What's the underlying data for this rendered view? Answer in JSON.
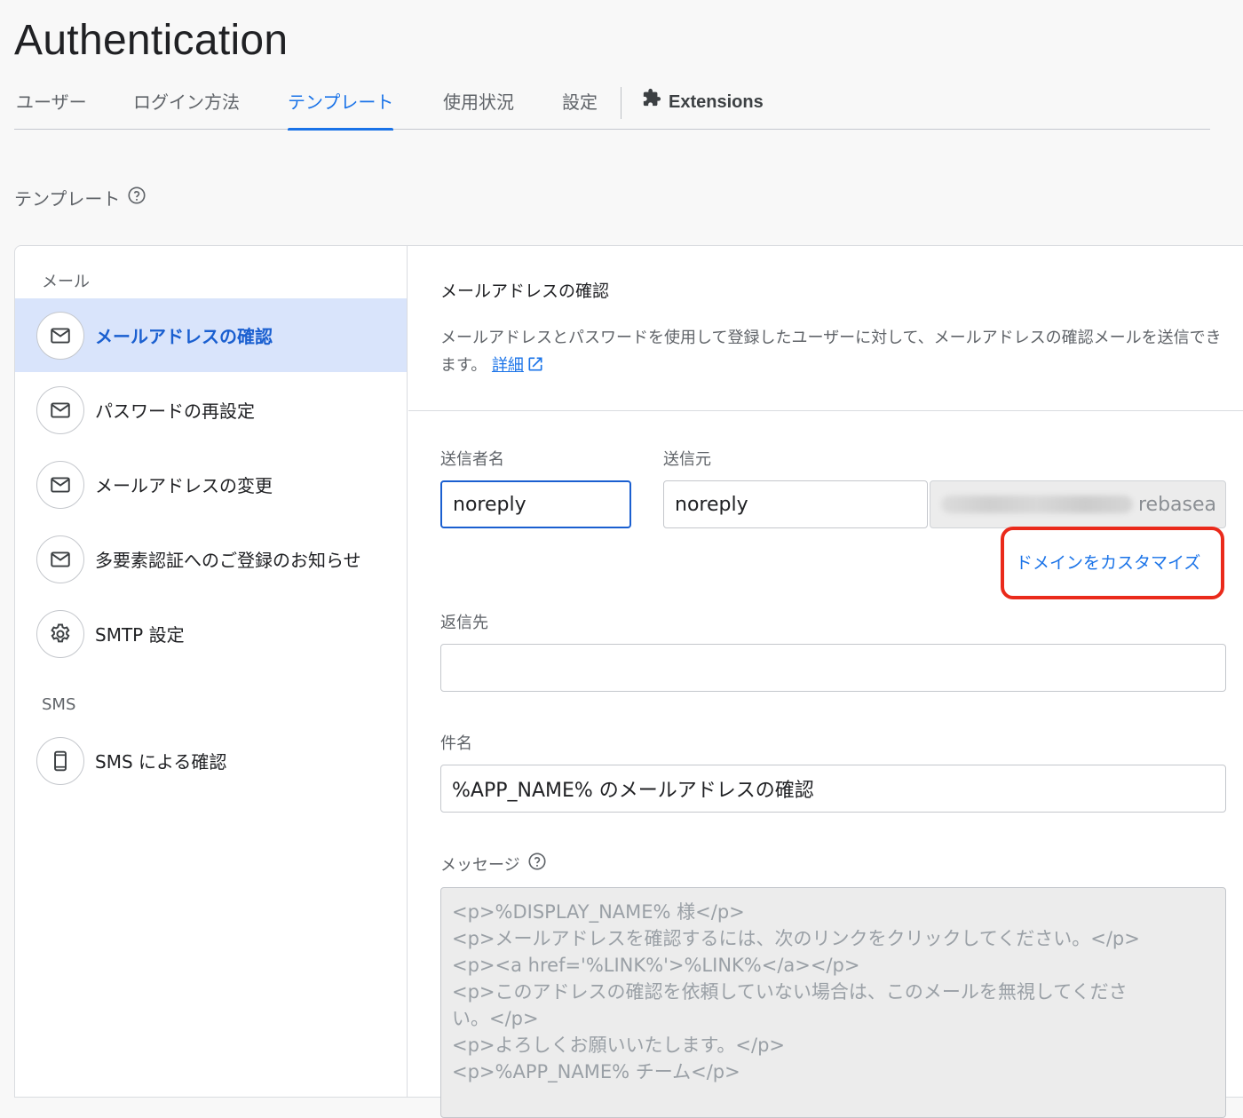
{
  "page": {
    "title": "Authentication"
  },
  "tabs": [
    {
      "label": "ユーザー"
    },
    {
      "label": "ログイン方法"
    },
    {
      "label": "テンプレート"
    },
    {
      "label": "使用状況"
    },
    {
      "label": "設定"
    }
  ],
  "extensions_tab": {
    "label": "Extensions",
    "icon": "puzzle-icon"
  },
  "section": {
    "label": "テンプレート",
    "help_icon": "help-circle-icon"
  },
  "sidebar": {
    "email_group_label": "メール",
    "sms_group_label": "SMS",
    "items": [
      {
        "label": "メールアドレスの確認",
        "icon": "mail-icon",
        "active": true
      },
      {
        "label": "パスワードの再設定",
        "icon": "mail-icon"
      },
      {
        "label": "メールアドレスの変更",
        "icon": "mail-icon"
      },
      {
        "label": "多要素認証へのご登録のお知らせ",
        "icon": "mail-icon"
      },
      {
        "label": "SMTP 設定",
        "icon": "gear-icon"
      },
      {
        "label": "SMS による確認",
        "icon": "phone-icon"
      }
    ]
  },
  "detail": {
    "title": "メールアドレスの確認",
    "description": "メールアドレスとパスワードを使用して登録したユーザーに対して、メールアドレスの確認メールを送信できます。",
    "learn_more": "詳細",
    "sender_name_label": "送信者名",
    "sender_name_value": "noreply",
    "from_label": "送信元",
    "from_value": "noreply",
    "domain_suffix": "rebasea",
    "customize_domain": "ドメインをカスタマイズ",
    "reply_to_label": "返信先",
    "reply_to_value": "",
    "subject_label": "件名",
    "subject_value": "%APP_NAME% のメールアドレスの確認",
    "message_label": "メッセージ",
    "message_lines": [
      "<p>%DISPLAY_NAME% 様</p>",
      "<p>メールアドレスを確認するには、次のリンクをクリックしてください。</p>",
      "<p><a href='%LINK%'>%LINK%</a></p>",
      "<p>このアドレスの確認を依頼していない場合は、このメールを無視してくださ",
      "い。</p>",
      "<p>よろしくお願いいたします。</p>",
      "<p>%APP_NAME% チーム</p>"
    ]
  },
  "colors": {
    "accent": "#1a73e8",
    "highlight_box": "#ea2a1b",
    "active_bg": "#d9e4fb"
  }
}
